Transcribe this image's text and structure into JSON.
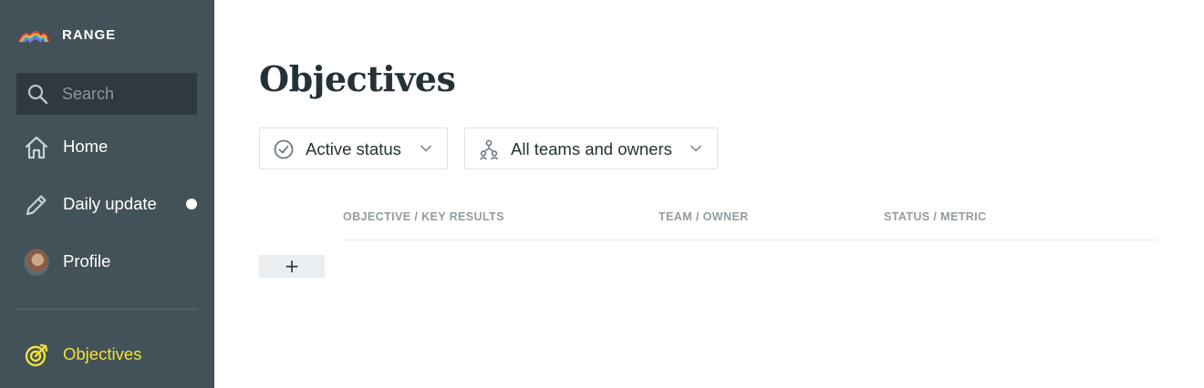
{
  "brand": {
    "name": "RANGE",
    "logo_icon": "rainbow-logo"
  },
  "sidebar": {
    "search": {
      "placeholder": "Search",
      "icon": "search-icon"
    },
    "items": [
      {
        "label": "Home",
        "icon": "home-icon"
      },
      {
        "label": "Daily update",
        "icon": "pencil-icon",
        "has_notification": true
      },
      {
        "label": "Profile",
        "icon": "avatar"
      },
      {
        "label": "Objectives",
        "icon": "target-icon",
        "active": true
      }
    ],
    "active_color": "#f0e13c"
  },
  "main": {
    "title": "Objectives",
    "filters": {
      "status": {
        "label": "Active status",
        "icon": "check-circle-icon"
      },
      "teams": {
        "label": "All teams and owners",
        "icon": "team-icon"
      }
    },
    "columns": [
      "OBJECTIVE / KEY RESULTS",
      "TEAM / OWNER",
      "STATUS / METRIC"
    ],
    "add_button": "+"
  },
  "colors": {
    "sidebar_bg": "#435158",
    "search_bg": "#2e3a40",
    "title": "#243238"
  }
}
